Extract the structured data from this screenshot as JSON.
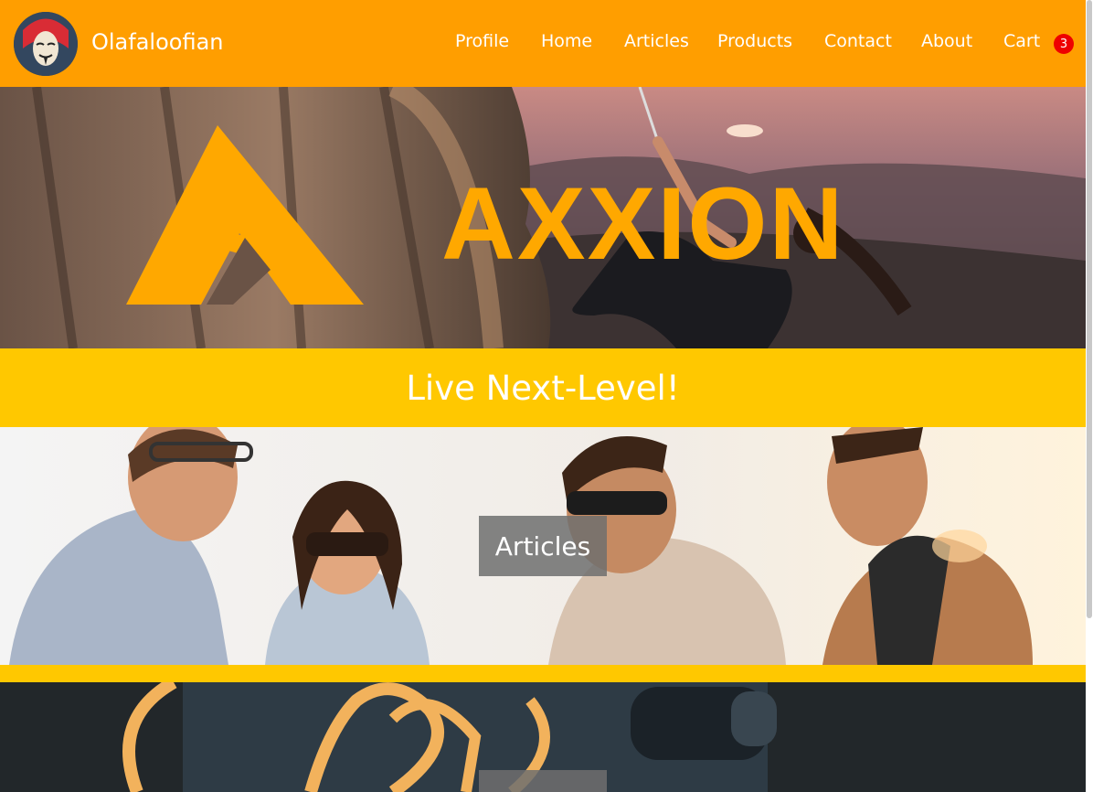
{
  "site": {
    "name": "Olafaloofian"
  },
  "nav": {
    "items": [
      {
        "label": "Profile"
      },
      {
        "label": "Home"
      },
      {
        "label": "Articles"
      },
      {
        "label": "Products"
      },
      {
        "label": "Contact"
      },
      {
        "label": "About"
      },
      {
        "label": "Cart"
      }
    ],
    "cart_count": "3"
  },
  "hero": {
    "logo_text": "AXXION",
    "tagline": "Live Next-Level!"
  },
  "sections": {
    "articles_label": "Articles"
  },
  "colors": {
    "nav_bg": "#ff9e00",
    "band": "#ffc800",
    "logo": "#ffa800",
    "badge": "#ee0000"
  }
}
